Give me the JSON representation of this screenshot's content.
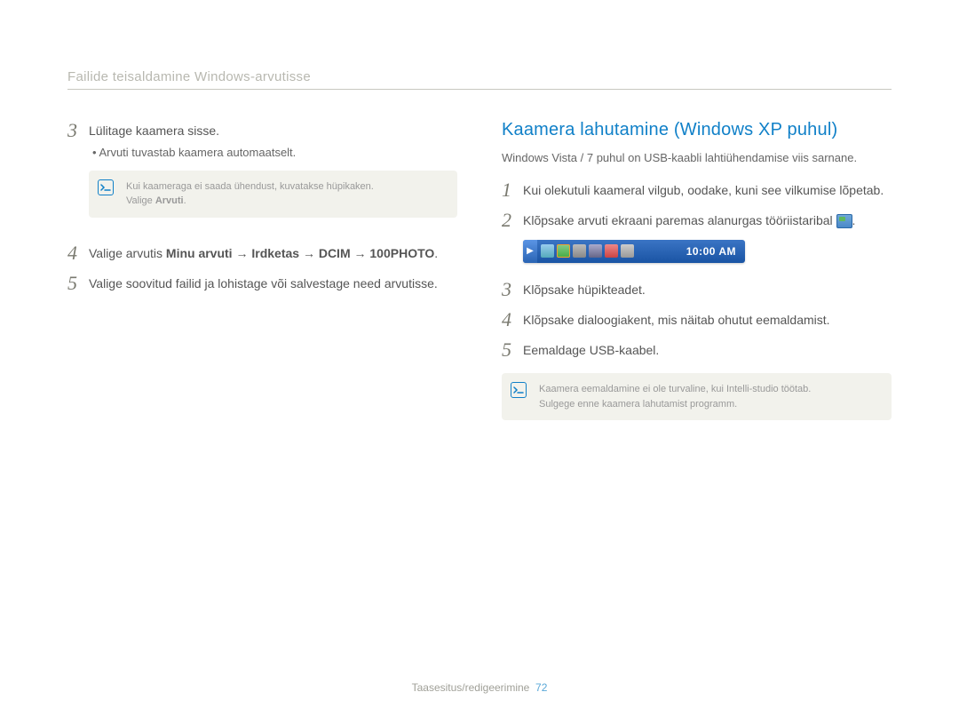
{
  "header": "Failide teisaldamine Windows-arvutisse",
  "left": {
    "steps": {
      "s3": {
        "num": "3",
        "text": "Lülitage kaamera sisse."
      },
      "s3_bullet": "Arvuti tuvastab kaamera automaatselt.",
      "note1_l1": "Kui kaameraga ei saada ühendust, kuvatakse hüpikaken.",
      "note1_l2a": "Valige ",
      "note1_l2b": "Arvuti",
      "note1_l2c": ".",
      "s4": {
        "num": "4",
        "pre": "Valige arvutis ",
        "b": "Minu arvuti → Irdketas → DCIM → 100PHOTO",
        "post": "."
      },
      "s5": {
        "num": "5",
        "text": "Valige soovitud failid ja lohistage või salvestage need arvutisse."
      }
    }
  },
  "right": {
    "title": "Kaamera lahutamine (Windows XP puhul)",
    "intro": "Windows Vista / 7 puhul on USB-kaabli lahtiühendamise viis sarnane.",
    "steps": {
      "s1": {
        "num": "1",
        "text": "Kui olekutuli kaameral vilgub, oodake, kuni see vilkumise lõpetab."
      },
      "s2": {
        "num": "2",
        "text_a": "Klõpsake arvuti ekraani paremas alanurgas tööriistaribal ",
        "text_b": "."
      },
      "clock": "10:00 AM",
      "s3": {
        "num": "3",
        "text": "Klõpsake hüpikteadet."
      },
      "s4": {
        "num": "4",
        "text": "Klõpsake dialoogiakent, mis näitab ohutut eemaldamist."
      },
      "s5": {
        "num": "5",
        "text": "Eemaldage USB-kaabel."
      }
    },
    "note2_l1": "Kaamera eemaldamine ei ole turvaline, kui Intelli-studio töötab.",
    "note2_l2": "Sulgege enne kaamera lahutamist programm."
  },
  "footer": {
    "label": "Taasesitus/redigeerimine",
    "page": "72"
  }
}
